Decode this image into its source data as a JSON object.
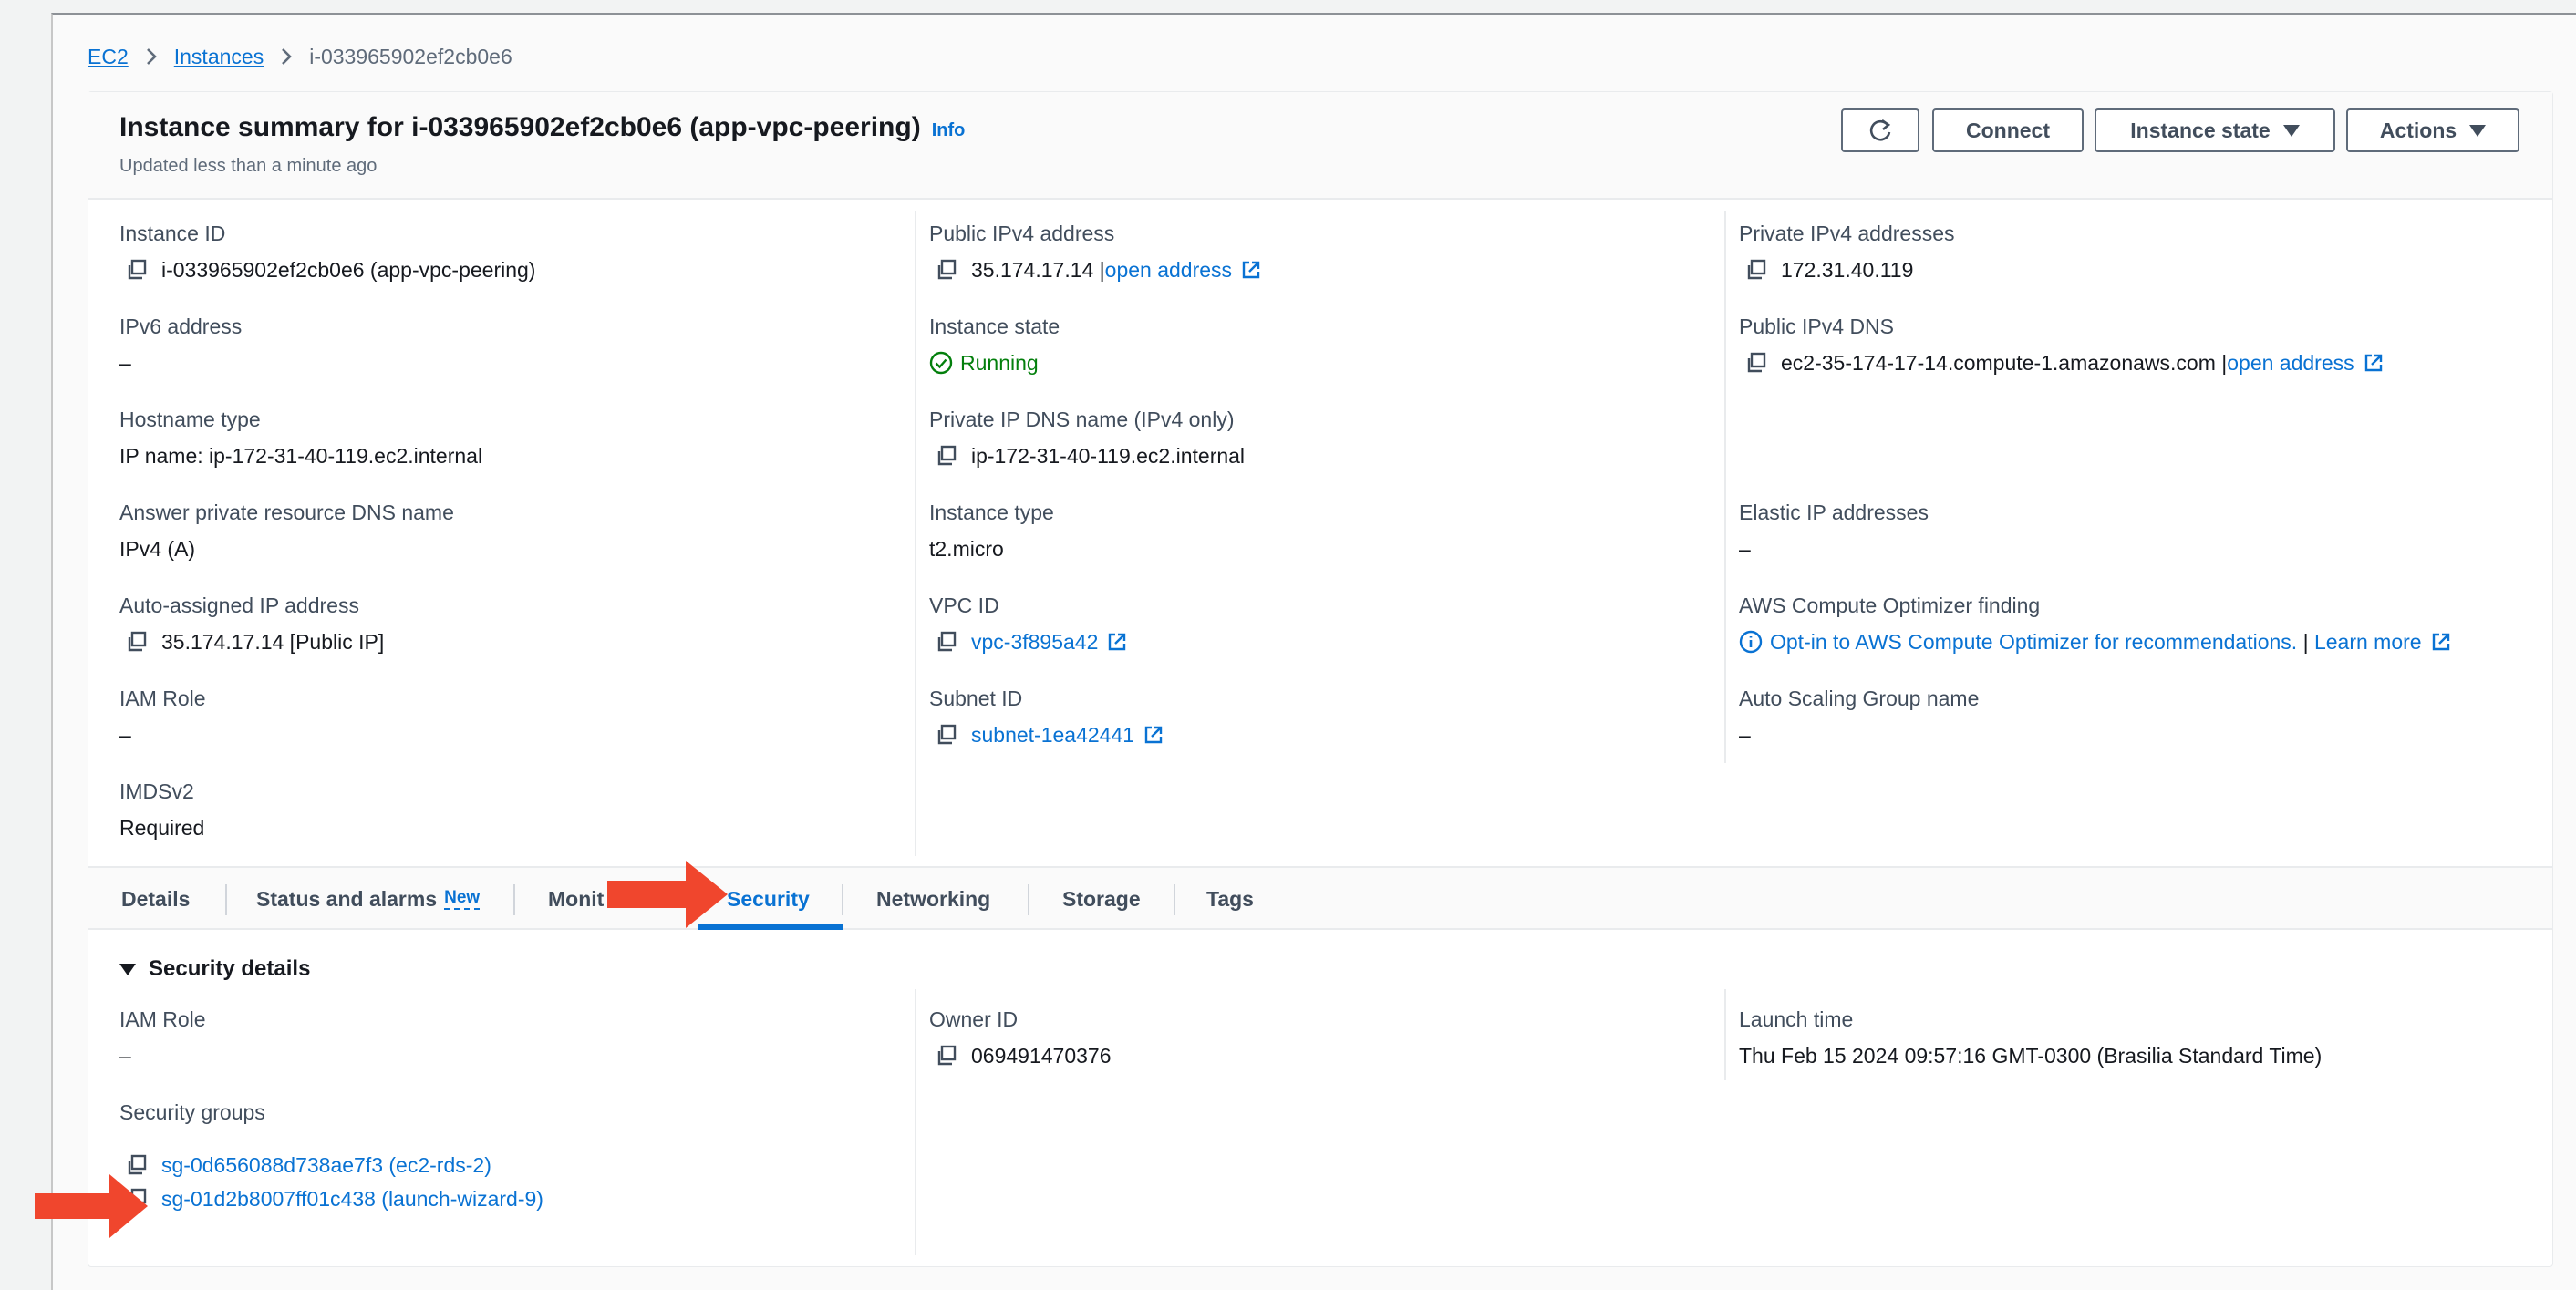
{
  "breadcrumb": {
    "items": [
      {
        "label": "EC2"
      },
      {
        "label": "Instances"
      },
      {
        "label": "i-033965902ef2cb0e6"
      }
    ]
  },
  "summary": {
    "title": "Instance summary for i-033965902ef2cb0e6 (app-vpc-peering)",
    "info_label": "Info",
    "updated": "Updated less than a minute ago",
    "buttons": {
      "refresh": "refresh-icon",
      "connect": "Connect",
      "instance_state": "Instance state",
      "actions": "Actions"
    }
  },
  "details": {
    "col1": [
      {
        "label": "Instance ID",
        "value": "i-033965902ef2cb0e6 (app-vpc-peering)"
      },
      {
        "label": "IPv6 address",
        "value": "–"
      },
      {
        "label": "Hostname type",
        "value": "IP name: ip-172-31-40-119.ec2.internal"
      },
      {
        "label": "Answer private resource DNS name",
        "value": "IPv4 (A)"
      },
      {
        "label": "Auto-assigned IP address",
        "value": "35.174.17.14 [Public IP]"
      },
      {
        "label": "IAM Role",
        "value": "–"
      },
      {
        "label": "IMDSv2",
        "value": "Required"
      }
    ],
    "col2": [
      {
        "label": "Public IPv4 address",
        "value": "35.174.17.14 |",
        "link": "open address"
      },
      {
        "label": "Instance state",
        "value": "Running"
      },
      {
        "label": "Private IP DNS name (IPv4 only)",
        "value": "ip-172-31-40-119.ec2.internal"
      },
      {
        "label": "Instance type",
        "value": "t2.micro"
      },
      {
        "label": "VPC ID",
        "value": "vpc-3f895a42"
      },
      {
        "label": "Subnet ID",
        "value": "subnet-1ea42441"
      }
    ],
    "col3": [
      {
        "label": "Private IPv4 addresses",
        "value": "172.31.40.119"
      },
      {
        "label": "Public IPv4 DNS",
        "value": "ec2-35-174-17-14.compute-1.amazonaws.com |",
        "link": "open address"
      },
      {
        "label": "Elastic IP addresses",
        "value": "–"
      },
      {
        "label": "AWS Compute Optimizer finding",
        "value": "Opt-in to AWS Compute Optimizer for recommendations.",
        "separator": " | ",
        "link": "Learn more"
      },
      {
        "label": "Auto Scaling Group name",
        "value": "–"
      }
    ]
  },
  "tabs": [
    {
      "label": "Details"
    },
    {
      "label": "Status and alarms",
      "badge": "New"
    },
    {
      "label": "Monit"
    },
    {
      "label": "Security",
      "active": true
    },
    {
      "label": "Networking"
    },
    {
      "label": "Storage"
    },
    {
      "label": "Tags"
    }
  ],
  "security": {
    "heading": "Security details",
    "iam_role": {
      "label": "IAM Role",
      "value": "–"
    },
    "security_groups": {
      "label": "Security groups",
      "items": [
        "sg-0d656088d738ae7f3 (ec2-rds-2)",
        "sg-01d2b8007ff01c438 (launch-wizard-9)"
      ]
    },
    "owner_id": {
      "label": "Owner ID",
      "value": "069491470376"
    },
    "launch_time": {
      "label": "Launch time",
      "value": "Thu Feb 15 2024 09:57:16 GMT-0300 (Brasilia Standard Time)"
    }
  },
  "colors": {
    "link": "#0972d3",
    "running": "#037f0c",
    "annotation_arrow": "#f0462d"
  }
}
